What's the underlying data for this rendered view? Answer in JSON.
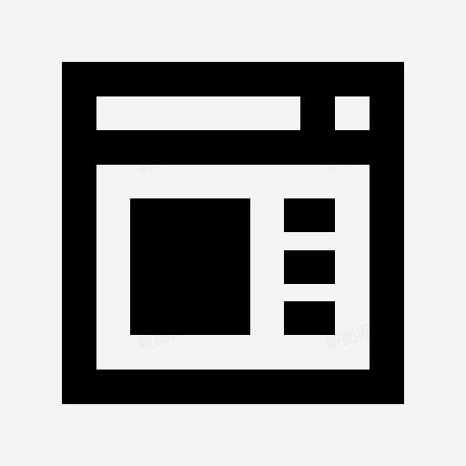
{
  "colors": {
    "background": "#f4f4f4",
    "icon": "#000000"
  },
  "icon": {
    "name": "browser-window-layout-icon"
  },
  "watermark": {
    "text": "新图网"
  }
}
